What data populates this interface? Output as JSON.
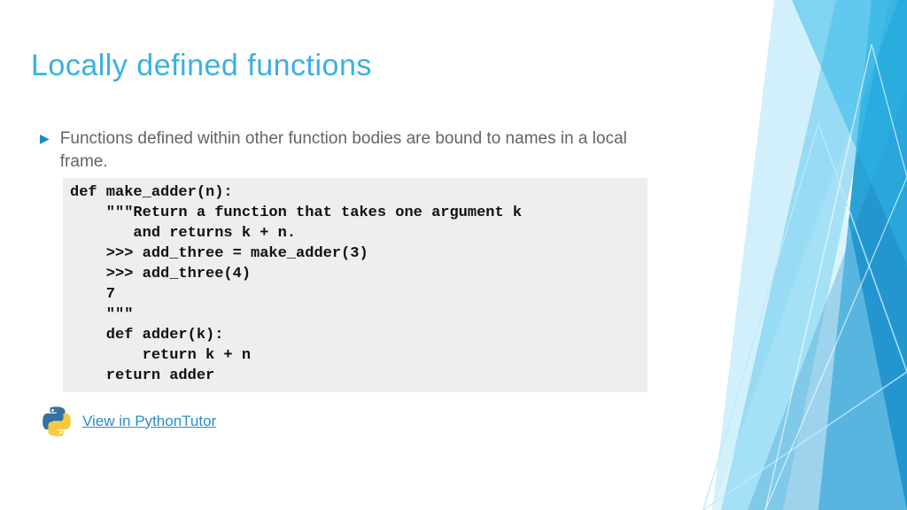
{
  "title": "Locally defined functions",
  "bullet": "Functions defined within other function bodies are bound to names in a local frame.",
  "code": "def make_adder(n):\n    \"\"\"Return a function that takes one argument k\n       and returns k + n.\n    >>> add_three = make_adder(3)\n    >>> add_three(4)\n    7\n    \"\"\"\n    def adder(k):\n        return k + n\n    return adder",
  "link": "View in PythonTutor"
}
